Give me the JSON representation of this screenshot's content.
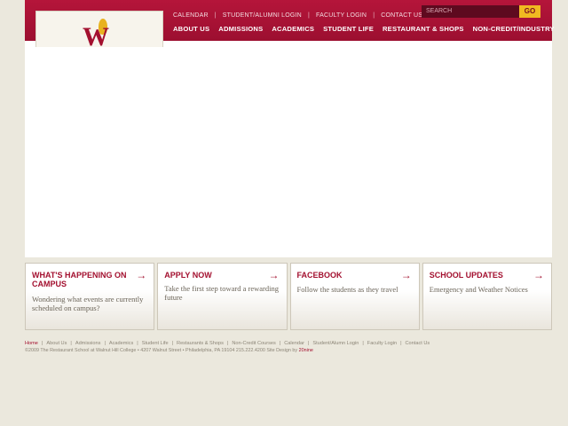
{
  "header": {
    "utility_links": [
      "CALENDAR",
      "STUDENT/ALUMNI LOGIN",
      "FACULTY LOGIN",
      "CONTACT US"
    ],
    "search_placeholder": "SEARCH",
    "search_button": "GO",
    "nav": [
      "ABOUT US",
      "ADMISSIONS",
      "ACADEMICS",
      "STUDENT LIFE",
      "RESTAURANT & SHOPS",
      "NON-CREDIT/INDUSTRY"
    ],
    "logo_letter": "W"
  },
  "promos": [
    {
      "title": "WHAT'S HAPPENING ON CAMPUS",
      "desc": "Wondering what events are currently scheduled on campus?"
    },
    {
      "title": "APPLY NOW",
      "desc": "Take the first step toward a rewarding future"
    },
    {
      "title": "FACEBOOK",
      "desc": "Follow the students as they travel"
    },
    {
      "title": "SCHOOL UPDATES",
      "desc": "Emergency and Weather Notices"
    }
  ],
  "footer": {
    "links": [
      "Home",
      "About Us",
      "Admissions",
      "Academics",
      "Student Life",
      "Restaurants & Shops",
      "Non-Credit Courses",
      "Calendar",
      "Student/Alumn Login",
      "Faculty Login",
      "Contact Us"
    ],
    "copyright": "©2009 The Restaurant School at Walnut Hill College • 4207 Walnut Street • Philadelphia, PA 19104 215.222.4200 Site Design by ",
    "designer": "20nine"
  },
  "colors": {
    "brand": "#a3102f",
    "accent": "#f0b921",
    "background": "#ebe8dd"
  }
}
